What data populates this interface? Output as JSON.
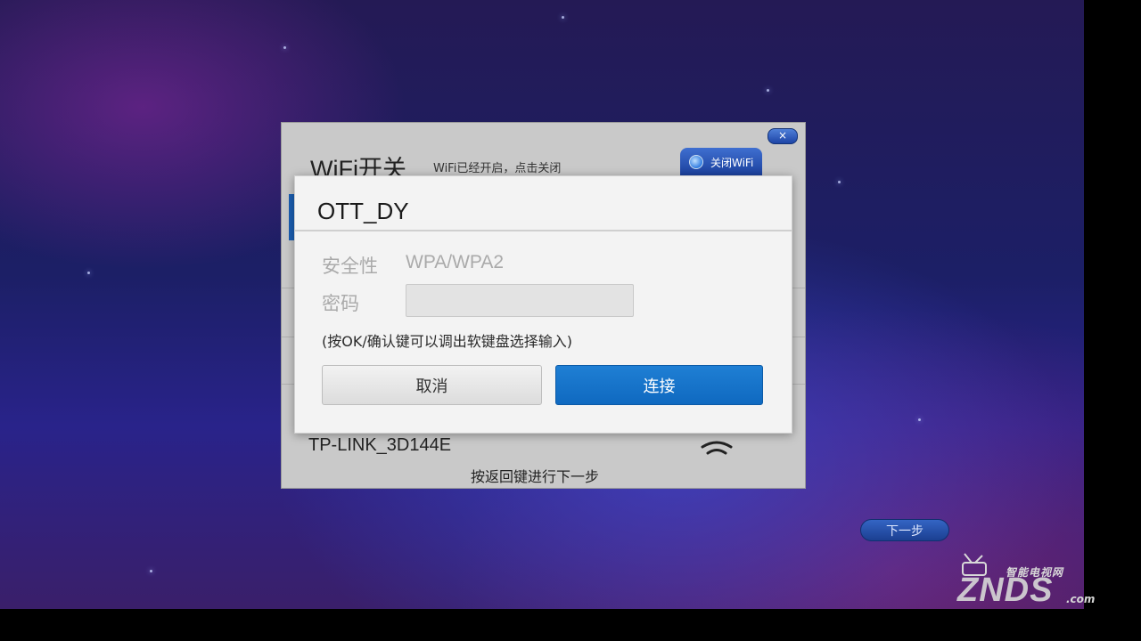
{
  "panel": {
    "title": "WiFi开关",
    "subtitle": "WiFi已经开启，点击关闭",
    "toggle_label": "关闭WiFi",
    "close_glyph": "×",
    "network_name": "TP-LINK_3D144E",
    "back_hint": "按返回键进行下一步"
  },
  "dialog": {
    "title": "OTT_DY",
    "security_label": "安全性",
    "security_value": "WPA/WPA2",
    "password_label": "密码",
    "password_value": "",
    "hint": "(按OK/确认键可以调出软键盘选择输入)",
    "cancel_label": "取消",
    "connect_label": "连接"
  },
  "next_button": "下一步",
  "watermark": {
    "small": "智能电视网",
    "big": "ZNDS",
    "suffix": ".com"
  },
  "colors": {
    "accent": "#1272c9",
    "panel_bg": "#c9c9c9",
    "dialog_bg": "#f3f3f3"
  },
  "icons": [
    "close-icon",
    "wifi-toggle-icon",
    "wifi-signal-icon"
  ]
}
